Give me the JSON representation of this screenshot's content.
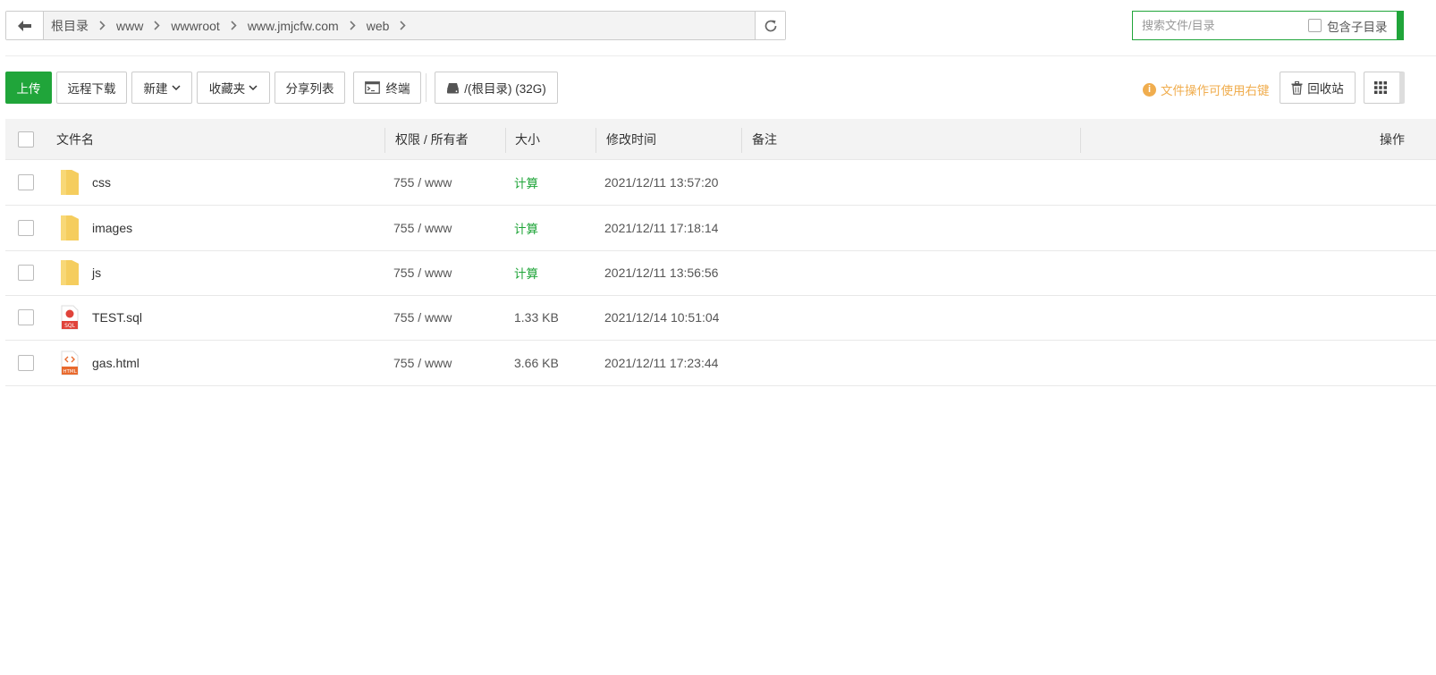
{
  "colors": {
    "accent": "#20a53a",
    "warning": "#f0ad4e",
    "folder": "#f5cd5e"
  },
  "address_bar": {
    "back_icon": "arrow-left-icon",
    "crumbs": [
      {
        "label": "根目录"
      },
      {
        "label": "www"
      },
      {
        "label": "wwwroot"
      },
      {
        "label": "www.jmjcfw.com"
      },
      {
        "label": "web"
      }
    ],
    "refresh_icon": "refresh-icon"
  },
  "search": {
    "placeholder": "搜索文件/目录",
    "include_sub_label": "包含子目录"
  },
  "toolbar": {
    "upload": "上传",
    "remote_download": "远程下载",
    "new": "新建",
    "favorites": "收藏夹",
    "share_list": "分享列表",
    "terminal": "终端",
    "disk": "/(根目录) (32G)",
    "tip": "文件操作可使用右键",
    "recycle": "回收站"
  },
  "table": {
    "headers": {
      "name": "文件名",
      "perm": "权限 / 所有者",
      "size": "大小",
      "mtime": "修改时间",
      "note": "备注",
      "ops": "操作"
    },
    "rows": [
      {
        "type": "folder",
        "icon": "folder-icon",
        "name": "css",
        "perm": "755 / www",
        "size": "计算",
        "mtime": "2021/12/11 13:57:20"
      },
      {
        "type": "folder",
        "icon": "folder-icon",
        "name": "images",
        "perm": "755 / www",
        "size": "计算",
        "mtime": "2021/12/11 17:18:14"
      },
      {
        "type": "folder",
        "icon": "folder-icon",
        "name": "js",
        "perm": "755 / www",
        "size": "计算",
        "mtime": "2021/12/11 13:56:56"
      },
      {
        "type": "sql",
        "icon": "sql-file-icon",
        "name": "TEST.sql",
        "perm": "755 / www",
        "size": "1.33 KB",
        "mtime": "2021/12/14 10:51:04"
      },
      {
        "type": "html",
        "icon": "html-file-icon",
        "name": "gas.html",
        "perm": "755 / www",
        "size": "3.66 KB",
        "mtime": "2021/12/11 17:23:44"
      }
    ]
  }
}
